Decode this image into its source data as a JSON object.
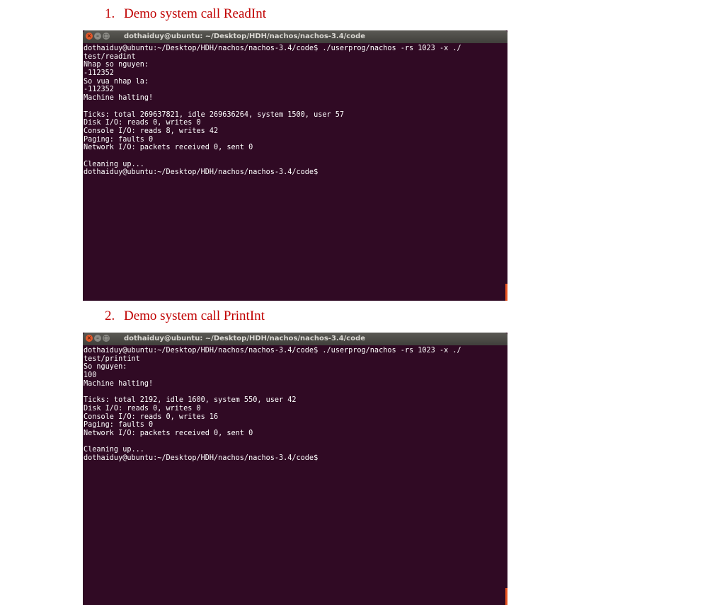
{
  "section1": {
    "number": "1.",
    "title": "Demo system call ReadInt",
    "terminal": {
      "title": "dothaiduy@ubuntu: ~/Desktop/HDH/nachos/nachos-3.4/code",
      "lines": [
        "dothaiduy@ubuntu:~/Desktop/HDH/nachos/nachos-3.4/code$ ./userprog/nachos -rs 1023 -x ./",
        "test/readint",
        "Nhap so nguyen:",
        "-112352",
        "So vua nhap la:",
        "-112352",
        "Machine halting!",
        "",
        "Ticks: total 269637821, idle 269636264, system 1500, user 57",
        "Disk I/O: reads 0, writes 0",
        "Console I/O: reads 8, writes 42",
        "Paging: faults 0",
        "Network I/O: packets received 0, sent 0",
        "",
        "Cleaning up...",
        "dothaiduy@ubuntu:~/Desktop/HDH/nachos/nachos-3.4/code$"
      ]
    }
  },
  "section2": {
    "number": "2.",
    "title": "Demo system call PrintInt",
    "terminal": {
      "title": "dothaiduy@ubuntu: ~/Desktop/HDH/nachos/nachos-3.4/code",
      "lines": [
        "dothaiduy@ubuntu:~/Desktop/HDH/nachos/nachos-3.4/code$ ./userprog/nachos -rs 1023 -x ./",
        "test/printint",
        "So nguyen:",
        "100",
        "Machine halting!",
        "",
        "Ticks: total 2192, idle 1600, system 550, user 42",
        "Disk I/O: reads 0, writes 0",
        "Console I/O: reads 0, writes 16",
        "Paging: faults 0",
        "Network I/O: packets received 0, sent 0",
        "",
        "Cleaning up...",
        "dothaiduy@ubuntu:~/Desktop/HDH/nachos/nachos-3.4/code$"
      ]
    }
  },
  "colors": {
    "heading": "#c00000",
    "terminal_bg": "#300a24",
    "terminal_fg": "#ffffff",
    "titlebar": "#4a4945",
    "close_button": "#e2582b",
    "scroll_marker": "#e95420"
  },
  "icons": [
    "close-icon",
    "minimize-icon",
    "maximize-icon"
  ]
}
